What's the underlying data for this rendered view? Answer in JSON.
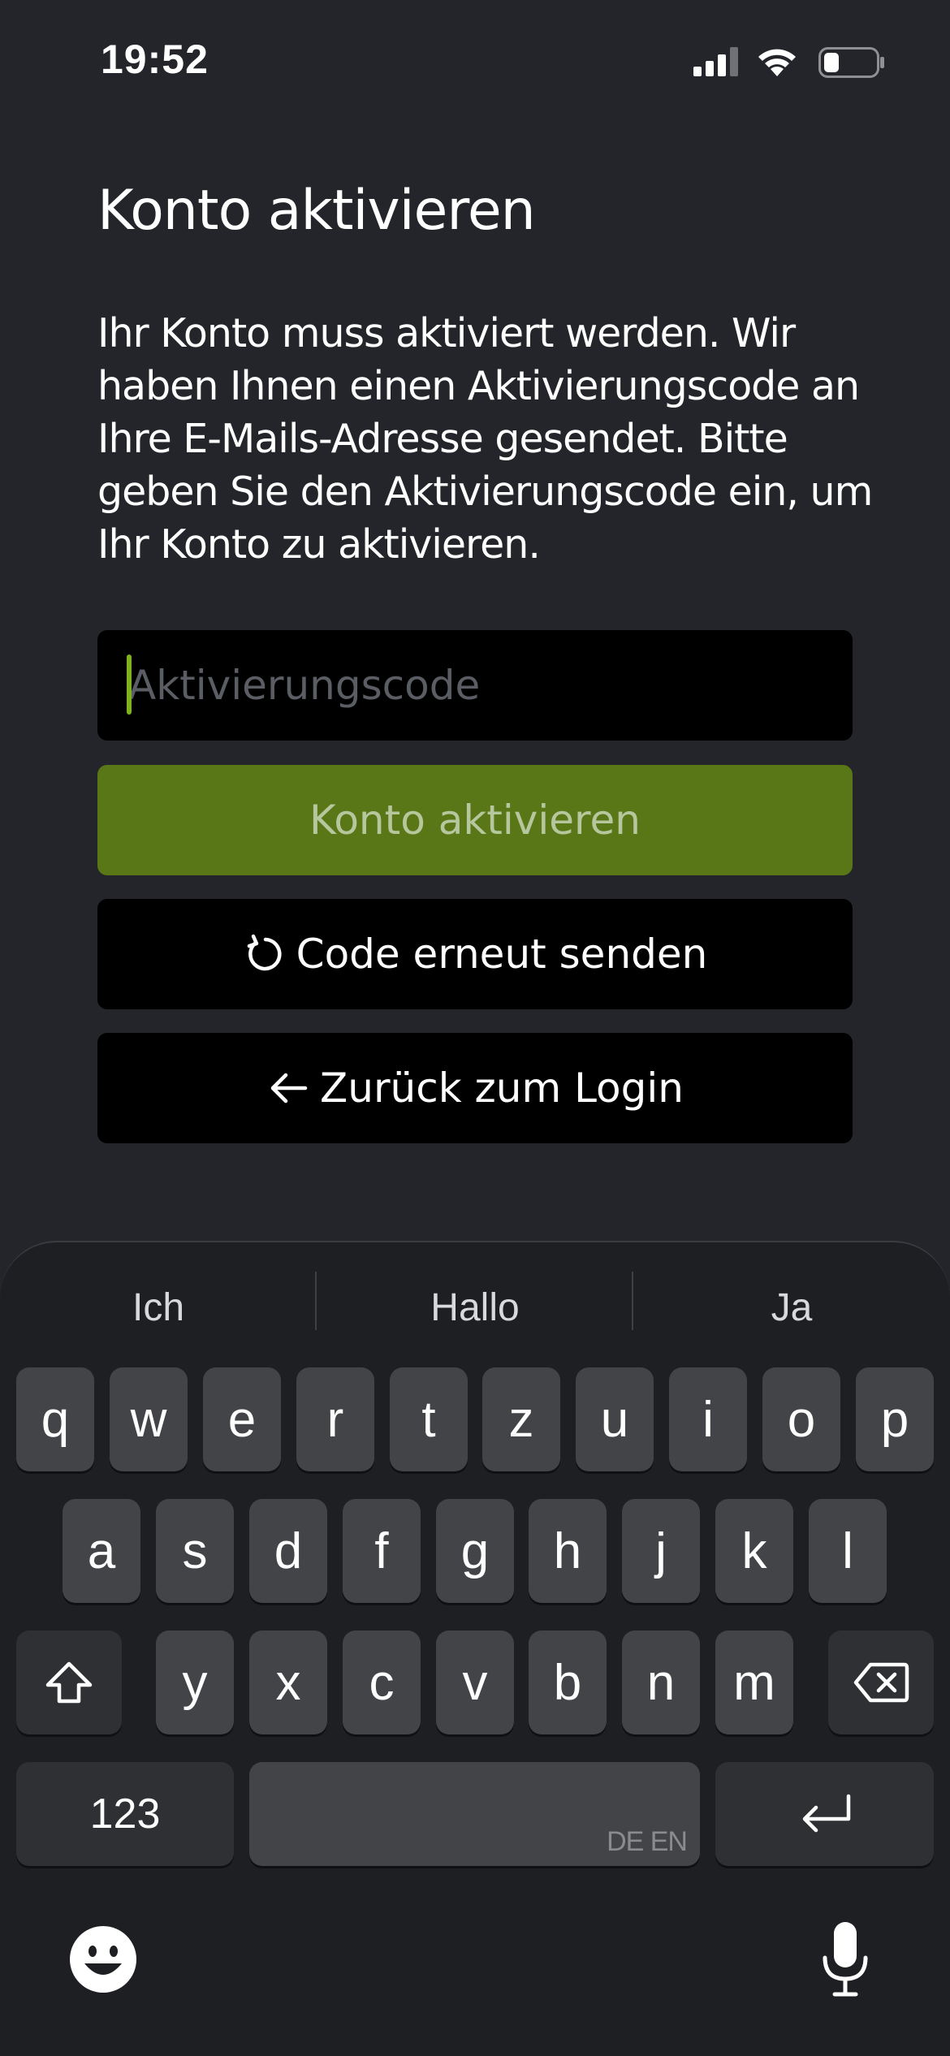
{
  "status_bar": {
    "time": "19:52",
    "icons": [
      "cellular-signal-icon",
      "wifi-icon",
      "battery-low-icon"
    ]
  },
  "page": {
    "title": "Konto aktivieren",
    "description": "Ihr Konto muss aktiviert werden. Wir haben Ihnen einen Aktivierungscode an Ihre E-Mails-Adresse gesendet. Bitte geben Sie den Aktivierungscode ein, um Ihr Konto zu aktivieren.",
    "code_input": {
      "placeholder": "Aktivierungscode",
      "value": ""
    },
    "activate_button": {
      "label": "Konto aktivieren"
    },
    "resend_button": {
      "label": "Code erneut senden",
      "icon": "refresh-icon"
    },
    "back_button": {
      "label": "Zurück zum Login",
      "icon": "arrow-left-icon"
    }
  },
  "colors": {
    "background": "#23252a",
    "accent": "#5a7718",
    "accent_text": "#b6c79e",
    "caret": "#7fb21d",
    "button_dark": "#000000"
  },
  "keyboard": {
    "suggestions": [
      "Ich",
      "Hallo",
      "Ja"
    ],
    "row1": [
      "q",
      "w",
      "e",
      "r",
      "t",
      "z",
      "u",
      "i",
      "o",
      "p"
    ],
    "row2": [
      "a",
      "s",
      "d",
      "f",
      "g",
      "h",
      "j",
      "k",
      "l"
    ],
    "row3": [
      "y",
      "x",
      "c",
      "v",
      "b",
      "n",
      "m"
    ],
    "numbers_key": "123",
    "space_languages": "DE EN",
    "icons": [
      "shift-icon",
      "backspace-icon",
      "return-icon",
      "emoji-icon",
      "microphone-icon"
    ]
  }
}
